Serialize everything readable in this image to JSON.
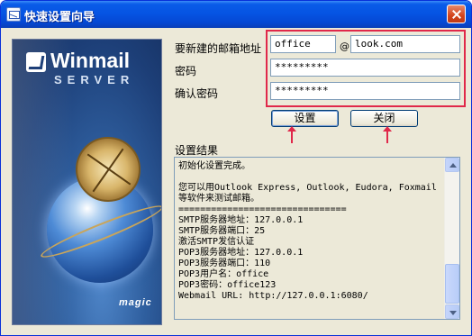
{
  "window": {
    "title": "快速设置向导"
  },
  "banner": {
    "logo_main": "Winmail",
    "logo_sub": "SERVER",
    "maker_logo": "magic"
  },
  "form": {
    "mailbox_label": "要新建的邮箱地址",
    "mailbox_user": "office",
    "at_sign": "@",
    "mailbox_domain": "look.com",
    "password_label": "密码",
    "password_value": "*********",
    "confirm_label": "确认密码",
    "confirm_value": "*********"
  },
  "buttons": {
    "setup_label": "设置",
    "close_label": "关闭"
  },
  "result": {
    "label": "设置结果",
    "text": "初始化设置完成。\n\n您可以用Outlook Express, Outlook, Eudora, Foxmail等软件来测试邮箱。\n===============================\nSMTP服务器地址：127.0.0.1\nSMTP服务器端口：25\n激活SMTP发信认证\nPOP3服务器地址：127.0.0.1\nPOP3服务器端口：110\nPOP3用户名：office\nPOP3密码：office123\nWebmail URL: http://127.0.0.1:6080/"
  },
  "colors": {
    "highlight": "#e0284a",
    "titlebar": "#0554e3",
    "dialog_bg": "#ece9d8"
  }
}
